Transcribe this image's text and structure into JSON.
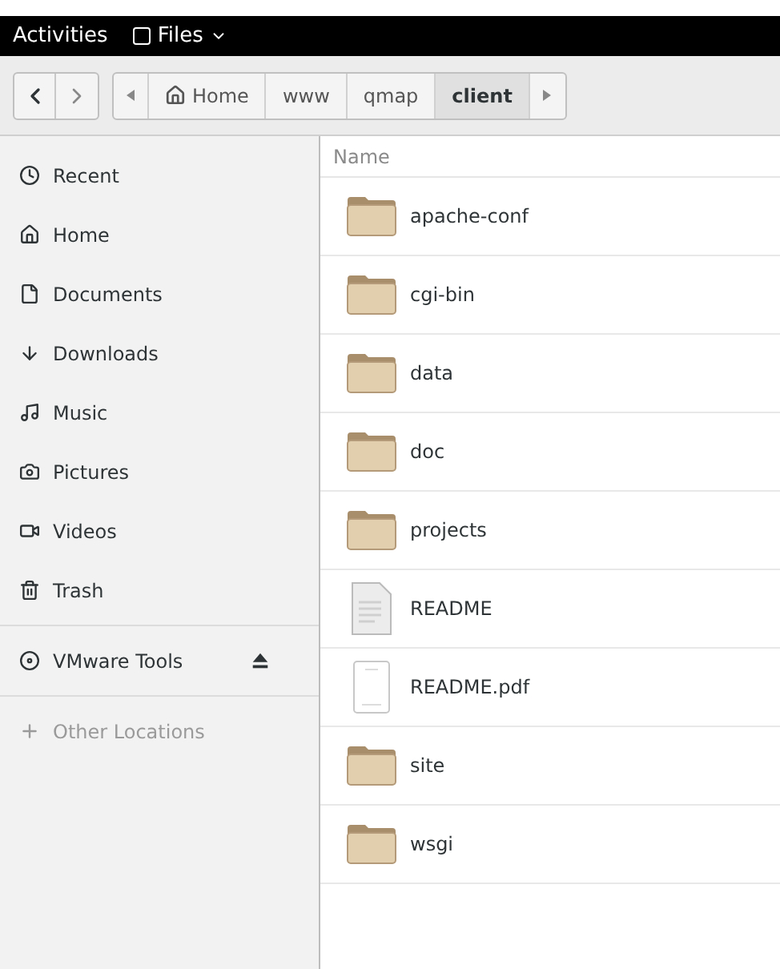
{
  "top_bar": {
    "activities": "Activities",
    "app_menu": "Files"
  },
  "breadcrumbs": [
    {
      "label": "Home",
      "kind": "home",
      "selected": false
    },
    {
      "label": "www",
      "kind": "plain",
      "selected": false
    },
    {
      "label": "qmap",
      "kind": "plain",
      "selected": false
    },
    {
      "label": "client",
      "kind": "plain",
      "selected": true
    }
  ],
  "sidebar": {
    "items": [
      {
        "label": "Recent",
        "kind": "recent"
      },
      {
        "label": "Home",
        "kind": "home"
      },
      {
        "label": "Documents",
        "kind": "documents"
      },
      {
        "label": "Downloads",
        "kind": "downloads"
      },
      {
        "label": "Music",
        "kind": "music"
      },
      {
        "label": "Pictures",
        "kind": "pictures"
      },
      {
        "label": "Videos",
        "kind": "videos"
      },
      {
        "label": "Trash",
        "kind": "trash"
      },
      {
        "label": "VMware Tools",
        "kind": "device"
      },
      {
        "label": "Other Locations",
        "kind": "other"
      }
    ]
  },
  "file_list": {
    "columns": [
      "Name"
    ],
    "rows": [
      {
        "name": "apache-conf",
        "kind": "folder"
      },
      {
        "name": "cgi-bin",
        "kind": "folder"
      },
      {
        "name": "data",
        "kind": "folder"
      },
      {
        "name": "doc",
        "kind": "folder"
      },
      {
        "name": "projects",
        "kind": "folder"
      },
      {
        "name": "README",
        "kind": "text"
      },
      {
        "name": "README.pdf",
        "kind": "pdf"
      },
      {
        "name": "site",
        "kind": "folder"
      },
      {
        "name": "wsgi",
        "kind": "folder"
      }
    ]
  }
}
